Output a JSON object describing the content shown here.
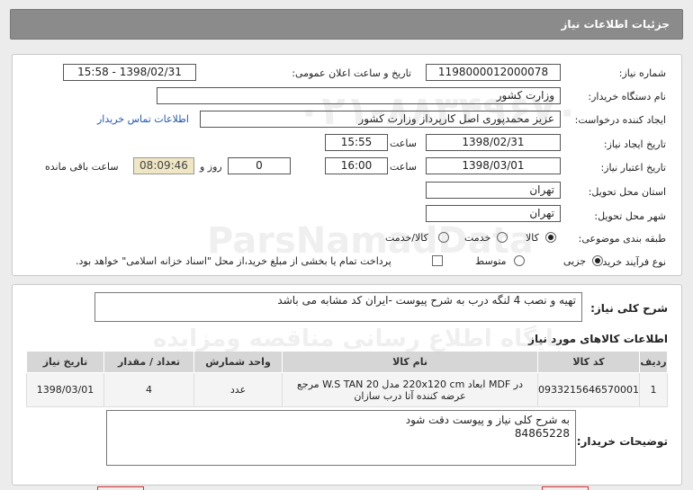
{
  "header": {
    "title": "جزئیات اطلاعات نیاز"
  },
  "form": {
    "need_number_label": "شماره نیاز:",
    "need_number": "1198000012000078",
    "announce_label": "تاریخ و ساعت اعلان عمومی:",
    "announce_value": "1398/02/31 - 15:58",
    "buyer_org_label": "نام دستگاه خریدار:",
    "buyer_org": "وزارت کشور",
    "requester_label": "ایجاد کننده درخواست:",
    "requester": "عزیز محمدپوری اصل کارپرداز وزارت کشور",
    "contact_link": "اطلاعات تماس خریدار",
    "created_label": "تاریخ ایجاد نیاز:",
    "created_date": "1398/02/31",
    "time_label": "ساعت",
    "created_time": "15:55",
    "validity_label": "تاریخ اعتبار نیاز:",
    "validity_date": "1398/03/01",
    "validity_time": "16:00",
    "days_label": "روز و",
    "days_value": "0",
    "remaining_time": "08:09:46",
    "remaining_label": "ساعت باقی مانده",
    "province_label": "استان محل تحویل:",
    "province": "تهران",
    "city_label": "شهر محل تحویل:",
    "city": "تهران",
    "category_label": "طبقه بندی موضوعی:",
    "category_options": [
      "کالا",
      "خدمت",
      "کالا/خدمت"
    ],
    "process_label": "نوع فرآیند خرید :",
    "process_options": [
      "جزیی",
      "متوسط"
    ],
    "payment_note": "پرداخت تمام یا بخشی از مبلغ خرید،از محل \"اسناد خزانه اسلامی\" خواهد بود."
  },
  "summary": {
    "label": "شرح کلی نیاز:",
    "text": "تهیه و نصب 4 لنگه درب به شرح پیوست -ایران کد مشابه می باشد"
  },
  "items": {
    "title": "اطلاعات کالاهای مورد نیاز",
    "columns": [
      "ردیف",
      "کد کالا",
      "نام کالا",
      "واحد شمارش",
      "تعداد / مقدار",
      "تاریخ نیاز"
    ],
    "rows": [
      {
        "row": "1",
        "code": "0933215646570001",
        "name": "در MDF ابعاد 220x120 cm مدل W.S TAN 20 مرجع عرضه کننده آتا درب سازان",
        "unit": "عدد",
        "qty": "4",
        "date": "1398/03/01"
      }
    ]
  },
  "buyer_notes": {
    "label": "توضیحات خریدار:",
    "line1": "به شرح کلی نیاز و پیوست دقت شود",
    "line2": "84865228"
  },
  "watermarks": {
    "w1": "ParsNamadData",
    "w2": "پایگاه اطلاع رسانی مناقصه ومزایده",
    "w3": "۰۲۱-۸۸۳۴۹۶۷۰"
  }
}
